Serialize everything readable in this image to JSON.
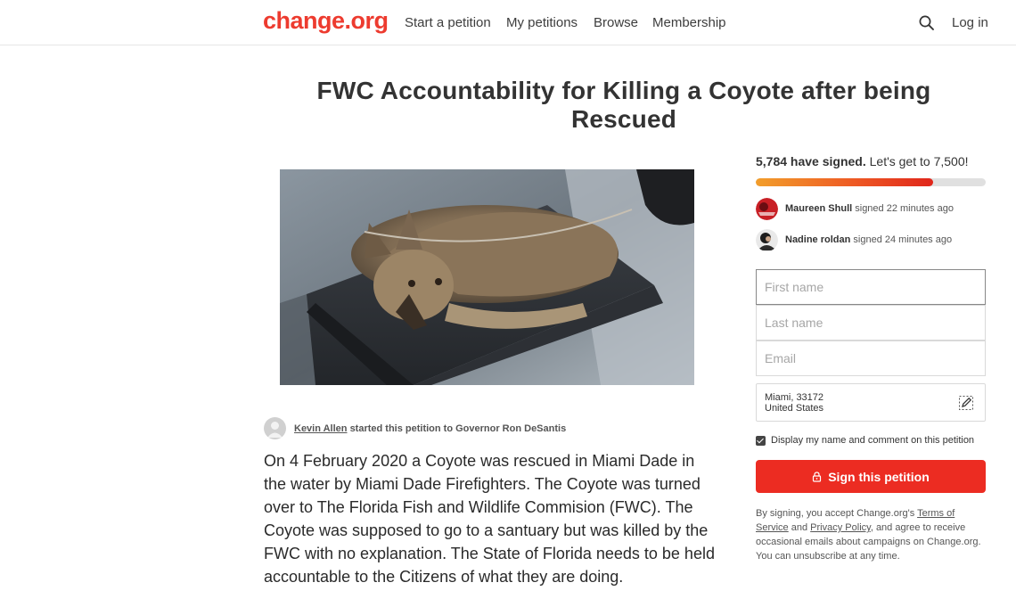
{
  "header": {
    "logo": "change.org",
    "nav": [
      "Start a petition",
      "My petitions",
      "Browse",
      "Membership"
    ],
    "search_icon": "search-icon",
    "login": "Log in",
    "brand_color": "#ed3b2f"
  },
  "petition": {
    "title": "FWC Accountability for Killing a Coyote after being Rescued",
    "starter_name": "Kevin Allen",
    "starter_suffix": "started this petition to Governor Ron DeSantis",
    "description": "On 4 February 2020 a Coyote was rescued in Miami Dade in the water by Miami Dade Firefighters.  The Coyote was turned over to The Florida Fish and Wildlife Commision (FWC).  The Coyote was supposed to go to a santuary but was killed by the FWC with no explanation.  The State of Florida needs to be held accountable to the Citizens of what they are doing."
  },
  "signatures": {
    "count_label": "5,784 have signed.",
    "goal_label": "Let's get to 7,500!",
    "progress_fraction": 0.7712,
    "recent": [
      {
        "name": "Maureen Shull",
        "time": "signed 22 minutes ago"
      },
      {
        "name": "Nadine roldan",
        "time": "signed 24 minutes ago"
      }
    ]
  },
  "form": {
    "first_name_placeholder": "First name",
    "last_name_placeholder": "Last name",
    "email_placeholder": "Email",
    "location_city": "Miami, 33172",
    "location_country": "United States",
    "display_label": "Display my name and comment on this petition",
    "sign_button": "Sign this petition",
    "accent_color": "#ec2c22"
  },
  "legal": {
    "prefix": "By signing, you accept Change.org's",
    "terms": "Terms of Service",
    "and": "and",
    "privacy": "Privacy Policy",
    "suffix": ", and agree to receive occasional emails about campaigns on Change.org. You can unsubscribe at any time."
  }
}
